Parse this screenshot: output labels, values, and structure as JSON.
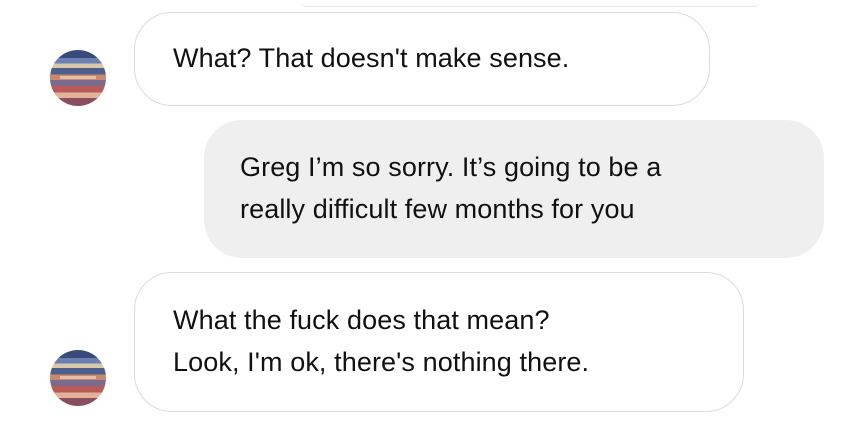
{
  "messages": [
    {
      "sender": "other",
      "lines": [
        "What? That doesn't make sense."
      ]
    },
    {
      "sender": "me",
      "lines": [
        "Greg I’m so sorry. It’s going to be a",
        "really difficult few months for you"
      ]
    },
    {
      "sender": "other",
      "lines": [
        "What the fuck does that mean?",
        "Look, I'm ok, there's nothing there."
      ]
    }
  ],
  "colors": {
    "incoming_bubble": "#ffffff",
    "incoming_border": "#dcdcdc",
    "outgoing_bubble": "#efefef",
    "text": "#111111"
  },
  "icons": {
    "avatar": "contact-avatar-icon"
  }
}
